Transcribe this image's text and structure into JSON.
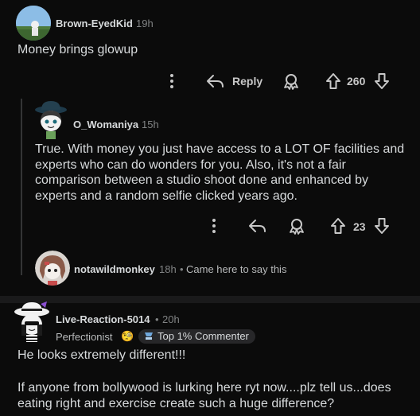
{
  "comments": [
    {
      "username": "Brown-EyedKid",
      "time": "19h",
      "text": "Money brings glowup",
      "actions": {
        "reply_label": "Reply",
        "score": "260"
      }
    },
    {
      "username": "O_Womaniya",
      "time": "15h",
      "text": "True. With money you just have access to a LOT OF facilities and experts who can do wonders for you. Also, it's not a fair comparison between a studio shoot done and enhanced by experts and a random selfie clicked years ago.",
      "actions": {
        "score": "23"
      }
    },
    {
      "username": "notawildmonkey",
      "time": "18h",
      "separator": "•",
      "text": "Came here to say this"
    },
    {
      "username": "Live-Reaction-5014",
      "separator": "•",
      "time": "20h",
      "flair": "Perfectionist",
      "flair_emoji": "🧐",
      "badge": "Top 1% Commenter",
      "text_line1": "He looks extremely different!!!",
      "text_line2": "If anyone from bollywood is lurking here ryt now....plz tell us...does eating right and exercise create such a huge difference?"
    }
  ],
  "icons": {
    "more": "more-options-icon",
    "reply": "reply-icon",
    "award": "award-icon",
    "upvote": "upvote-icon",
    "downvote": "downvote-icon"
  },
  "colors": {
    "background": "#0b0b0b",
    "text": "#d7dadc",
    "muted": "#818384",
    "divider": "#1a1a1b"
  }
}
